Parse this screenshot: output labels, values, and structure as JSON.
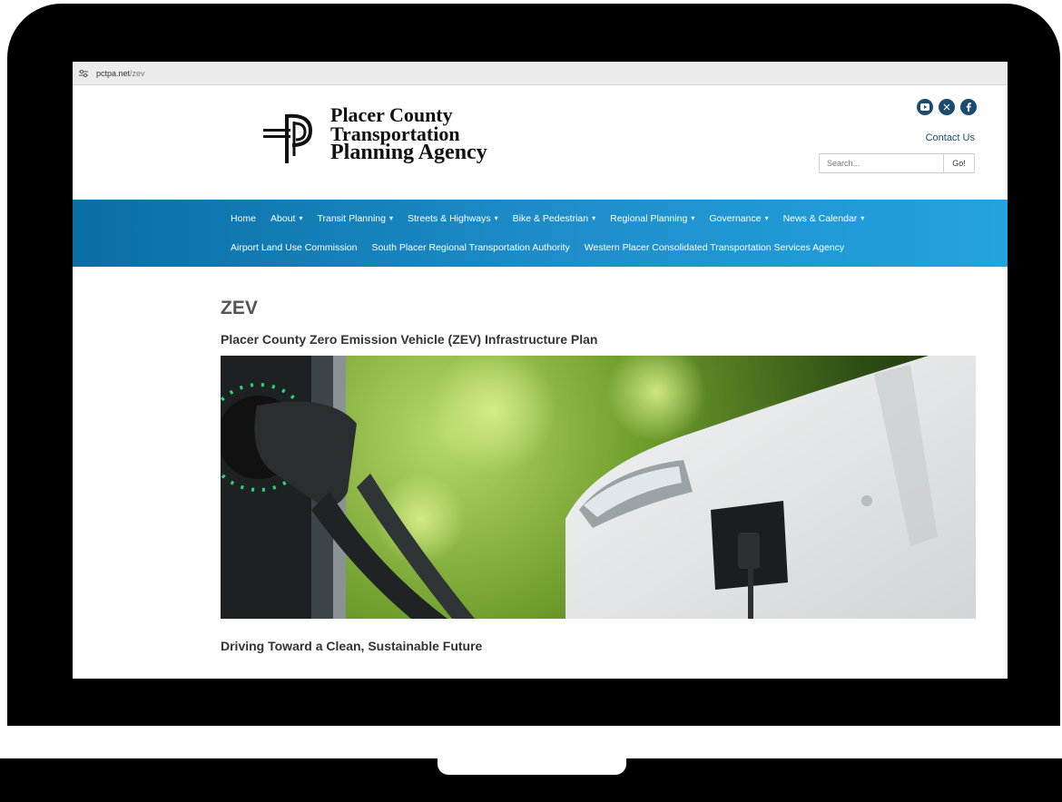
{
  "browser": {
    "url_domain": "pctpa.net",
    "url_path": "/zev"
  },
  "header": {
    "logo": {
      "line1": "Placer County",
      "line2": "Transportation",
      "line3": "Planning Agency"
    },
    "social": [
      "youtube-icon",
      "x-icon",
      "facebook-icon"
    ],
    "social_color": "#1a4a6e",
    "contact_label": "Contact Us",
    "search": {
      "placeholder": "Search...",
      "button_label": "Go!"
    }
  },
  "nav": {
    "row1": [
      {
        "label": "Home",
        "dropdown": false
      },
      {
        "label": "About",
        "dropdown": true
      },
      {
        "label": "Transit Planning",
        "dropdown": true
      },
      {
        "label": "Streets & Highways",
        "dropdown": true
      },
      {
        "label": "Bike & Pedestrian",
        "dropdown": true
      },
      {
        "label": "Regional Planning",
        "dropdown": true
      },
      {
        "label": "Governance",
        "dropdown": true
      },
      {
        "label": "News & Calendar",
        "dropdown": true
      }
    ],
    "row2": [
      {
        "label": "Airport Land Use Commission",
        "dropdown": false
      },
      {
        "label": "South Placer Regional Transportation Authority",
        "dropdown": false
      },
      {
        "label": "Western Placer Consolidated Transportation Services Agency",
        "dropdown": false
      }
    ],
    "caret": "▾",
    "accent": "#1f8fcc"
  },
  "main": {
    "title": "ZEV",
    "subtitle": "Placer County Zero Emission Vehicle (ZEV) Infrastructure Plan",
    "section_heading": "Driving Toward a Clean, Sustainable Future"
  }
}
